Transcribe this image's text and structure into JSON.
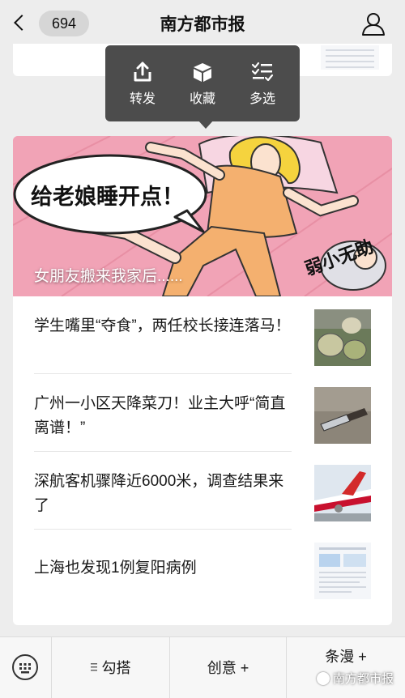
{
  "header": {
    "back_count": "694",
    "title": "南方都市报",
    "back_icon": "chevron-left-icon",
    "profile_icon": "user-icon"
  },
  "popup_menu": [
    {
      "label": "转发",
      "icon": "share-icon"
    },
    {
      "label": "收藏",
      "icon": "favorite-box-icon"
    },
    {
      "label": "多选",
      "icon": "multi-select-icon"
    }
  ],
  "featured": {
    "caption": "女朋友搬来我家后......",
    "speech_bubble": "给老娘睡开点！",
    "side_text": "弱小无助"
  },
  "articles": [
    {
      "title": "学生嘴里“夺食”，两任校长接连落马！"
    },
    {
      "title": "广州一小区天降菜刀！业主大呼“简直离谱！”"
    },
    {
      "title": "深航客机骤降近6000米，调查结果来了"
    },
    {
      "title": "上海也发现1例复阳病例"
    }
  ],
  "bottom_menu": {
    "keyboard_icon": "keyboard-icon",
    "items": [
      "勾搭",
      "创意 +",
      "条漫 +"
    ]
  },
  "watermark": "南方都市报",
  "colors": {
    "background": "#ededed",
    "popup": "#4c4c4c",
    "hero_pink": "#f2a4b7"
  }
}
